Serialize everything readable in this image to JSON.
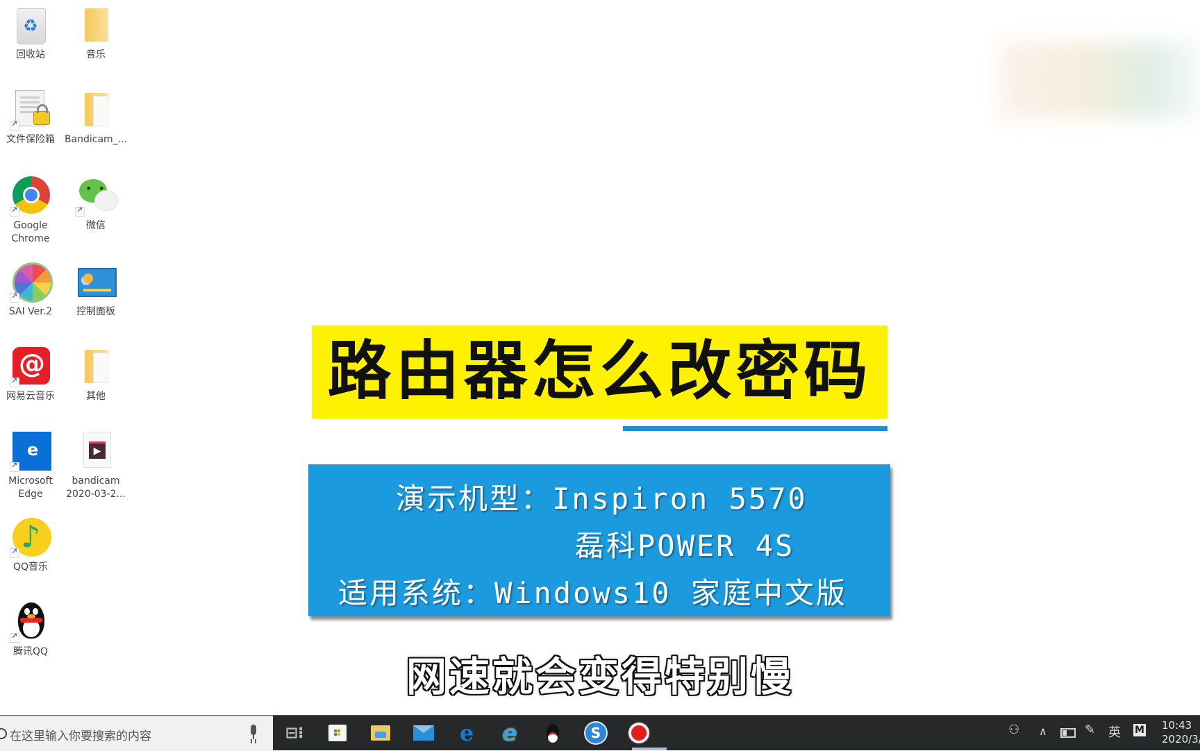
{
  "desktop": {
    "icons": [
      {
        "label": "回收站",
        "icon": "recycle-bin-icon"
      },
      {
        "label": "音乐",
        "icon": "folder-icon"
      },
      {
        "label": "文件保险箱",
        "icon": "file-vault-icon"
      },
      {
        "label": "Bandicam_...",
        "icon": "folder-icon"
      },
      {
        "label": "Google Chrome",
        "icon": "chrome-icon"
      },
      {
        "label": "微信",
        "icon": "wechat-icon"
      },
      {
        "label": "SAI Ver.2",
        "icon": "sai-icon"
      },
      {
        "label": "控制面板",
        "icon": "control-panel-icon"
      },
      {
        "label": "网易云音乐",
        "icon": "netease-music-icon"
      },
      {
        "label": "其他",
        "icon": "folder-icon"
      },
      {
        "label": "Microsoft Edge",
        "icon": "edge-icon"
      },
      {
        "label": "bandicam 2020-03-2...",
        "icon": "video-file-icon"
      },
      {
        "label": "QQ音乐",
        "icon": "qq-music-icon"
      },
      {
        "label": "腾讯QQ",
        "icon": "qq-icon"
      }
    ]
  },
  "overlay": {
    "title": "路由器怎么改密码",
    "info": {
      "line1": "演示机型：Inspiron 5570",
      "line2": "磊科POWER 4S",
      "line3": "适用系统：Windows10 家庭中文版"
    },
    "subtitle": "网速就会变得特别慢",
    "colors": {
      "title_bg": "#fff200",
      "info_bg": "#1c9ade",
      "underline": "#1a8fd6"
    }
  },
  "taskbar": {
    "search_placeholder": "在这里输入你要搜索的内容",
    "pinned": [
      "task-view",
      "microsoft-store",
      "file-explorer",
      "mail",
      "edge",
      "internet-explorer",
      "qq",
      "sogou",
      "bandicam-recorder"
    ],
    "tray": {
      "ime": "英",
      "m_badge": "M",
      "time": "10:43",
      "date": "2020/3/"
    }
  }
}
